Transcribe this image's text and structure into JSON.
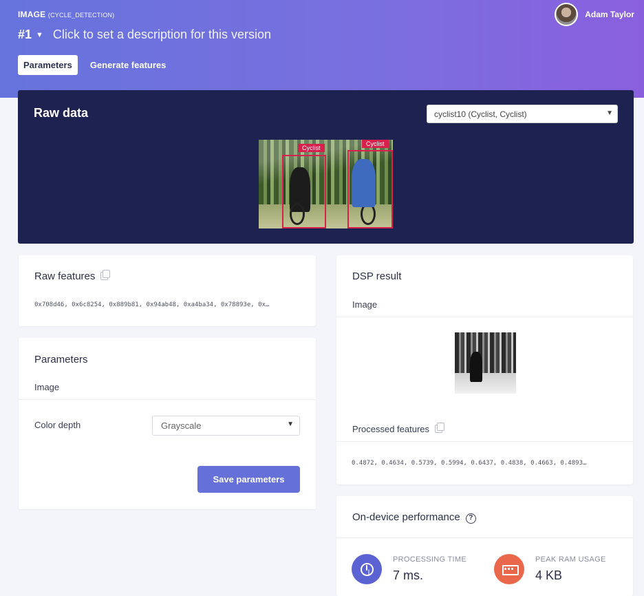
{
  "header": {
    "project": "IMAGE",
    "block": "(CYCLE_DETECTION)",
    "version_number": "#1",
    "version_description": "Click to set a description for this version",
    "user_name": "Adam Taylor"
  },
  "tabs": [
    {
      "label": "Parameters",
      "active": true
    },
    {
      "label": "Generate features",
      "active": false
    }
  ],
  "raw_data": {
    "title": "Raw data",
    "sample": "cyclist10 (Cyclist, Cyclist)",
    "labels": [
      "Cyclist",
      "Cyclist"
    ],
    "bbox_color": "#d8204c"
  },
  "raw_features": {
    "title": "Raw features",
    "values": "0x708d46, 0x6c8254, 0x889b81, 0x94ab48, 0xa4ba34, 0x78893e, 0x…"
  },
  "parameters": {
    "title": "Parameters",
    "section": "Image",
    "color_depth_label": "Color depth",
    "color_depth_value": "Grayscale",
    "save_label": "Save parameters"
  },
  "dsp_result": {
    "title": "DSP result",
    "section": "Image",
    "processed_title": "Processed features",
    "processed_values": "0.4872, 0.4634, 0.5739, 0.5994, 0.6437, 0.4838, 0.4663, 0.4893…"
  },
  "performance": {
    "title": "On-device performance",
    "processing_label": "PROCESSING TIME",
    "processing_value": "7 ms.",
    "ram_label": "PEAK RAM USAGE",
    "ram_value": "4 KB"
  },
  "colors": {
    "accent": "#6670d9",
    "header_start": "#6673dc",
    "header_end": "#8a5fde",
    "raw_panel": "#1e2250",
    "ram_icon": "#e9674a"
  },
  "icons": [
    "chevron-down-icon",
    "copy-icon",
    "help-icon",
    "clock-icon",
    "memory-icon"
  ]
}
